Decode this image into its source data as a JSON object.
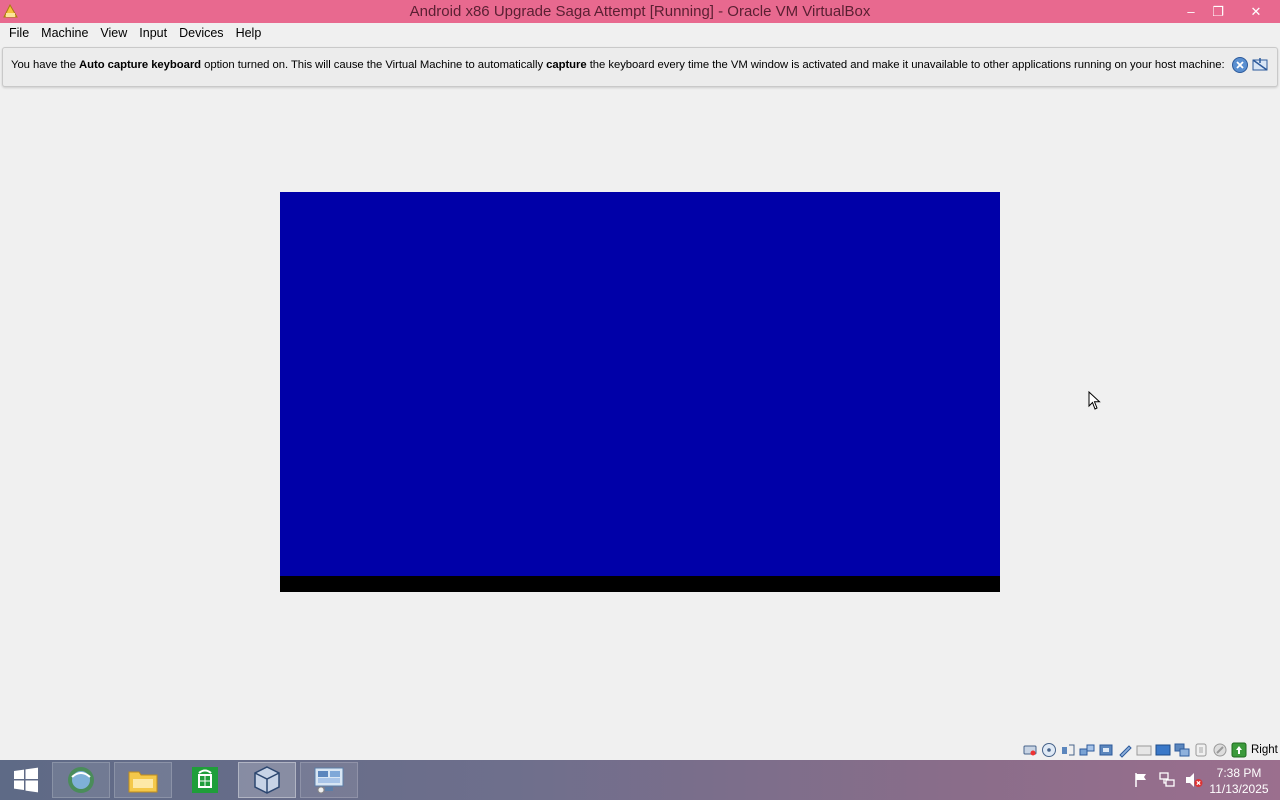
{
  "window": {
    "title": "Android x86 Upgrade Saga Attempt [Running] - Oracle VM VirtualBox",
    "controls": {
      "minimize": "–",
      "maximize": "❐",
      "close": "✕"
    }
  },
  "menubar": {
    "items": [
      {
        "label": "File"
      },
      {
        "label": "Machine"
      },
      {
        "label": "View"
      },
      {
        "label": "Input"
      },
      {
        "label": "Devices"
      },
      {
        "label": "Help"
      }
    ]
  },
  "notification": {
    "part1": "You have the ",
    "bold1": "Auto capture keyboard",
    "part2": " option turned on. This will cause the Virtual Machine to automatically ",
    "bold2": "capture",
    "part3": " the keyboard every time the VM window is activated and make it unavailable to other applications running on your host machine:",
    "icons": [
      "close-notification-icon",
      "do-not-show-again-icon"
    ]
  },
  "vm": {
    "screen_color": "#0000a8"
  },
  "statusbar": {
    "icons": [
      "hard-disk-icon",
      "optical-drive-icon",
      "audio-icon",
      "network-icon",
      "usb-icon",
      "shared-folders-icon",
      "display-icon",
      "recording-icon",
      "virtualization-icon",
      "mouse-integration-icon",
      "keyboard-capture-icon"
    ],
    "host_key": "Right Ctrl"
  },
  "taskbar": {
    "apps": [
      "start-icon",
      "browser-icon",
      "file-explorer-icon",
      "store-icon",
      "virtualbox-icon",
      "remote-desktop-icon"
    ],
    "tray_icons": [
      "action-center-flag-icon",
      "network-icon",
      "volume-muted-icon"
    ],
    "time": "7:38 PM",
    "date": "11/13/2025"
  },
  "colors": {
    "titlebar": "#e8698f",
    "vm_screen": "#0000a8",
    "window_bg": "#f0f0f0"
  }
}
